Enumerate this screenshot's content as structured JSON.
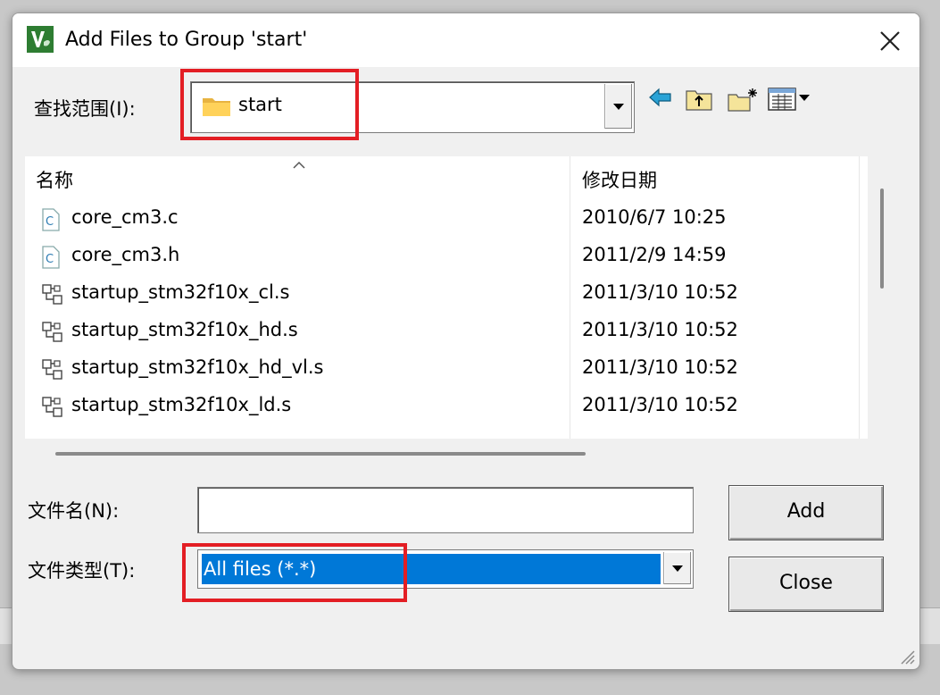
{
  "window": {
    "title": "Add Files to Group 'start'",
    "icon": "keil-uvision-icon"
  },
  "look_in": {
    "label": "查找范围(I):",
    "value": "start",
    "folder_icon": "folder-icon"
  },
  "toolbar": {
    "icons": [
      "back-arrow-icon",
      "up-folder-icon",
      "new-folder-icon",
      "view-menu-icon"
    ]
  },
  "file_list": {
    "columns": {
      "name": "名称",
      "modified": "修改日期"
    },
    "rows": [
      {
        "name": "core_cm3.c",
        "date": "2010/6/7 10:25",
        "icon": "c-file-icon"
      },
      {
        "name": "core_cm3.h",
        "date": "2011/2/9 14:59",
        "icon": "c-file-icon"
      },
      {
        "name": "startup_stm32f10x_cl.s",
        "date": "2011/3/10 10:52",
        "icon": "asm-file-icon"
      },
      {
        "name": "startup_stm32f10x_hd.s",
        "date": "2011/3/10 10:52",
        "icon": "asm-file-icon"
      },
      {
        "name": "startup_stm32f10x_hd_vl.s",
        "date": "2011/3/10 10:52",
        "icon": "asm-file-icon"
      },
      {
        "name": "startup_stm32f10x_ld.s",
        "date": "2011/3/10 10:52",
        "icon": "asm-file-icon"
      }
    ]
  },
  "file_name": {
    "label": "文件名(N):",
    "value": ""
  },
  "file_type": {
    "label": "文件类型(T):",
    "value": "All files (*.*)"
  },
  "buttons": {
    "add": "Add",
    "close": "Close"
  },
  "colors": {
    "highlight": "#0078d7",
    "annotation": "#e31e24"
  }
}
